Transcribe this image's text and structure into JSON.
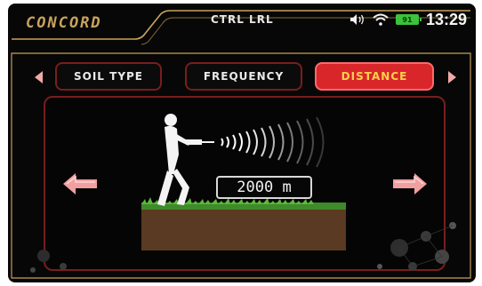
{
  "header": {
    "brand": "CONCORD",
    "mode": "CTRL LRL",
    "battery_level": "91",
    "time": "13:29"
  },
  "tabs": [
    {
      "label": "SOIL TYPE",
      "active": false
    },
    {
      "label": "FREQUENCY",
      "active": false
    },
    {
      "label": "DISTANCE",
      "active": true
    }
  ],
  "distance": {
    "value": "2000 m"
  },
  "icons": {
    "volume": "volume-icon",
    "wifi": "wifi-icon",
    "battery": "battery-icon"
  },
  "colors": {
    "accent_gold": "#c9a35c",
    "tab_border": "#7a1d1d",
    "active_tab": "#d8262b",
    "active_tab_text": "#ffd24a",
    "arrow_pink": "#f0a8a8",
    "battery_green": "#3cc23c"
  }
}
